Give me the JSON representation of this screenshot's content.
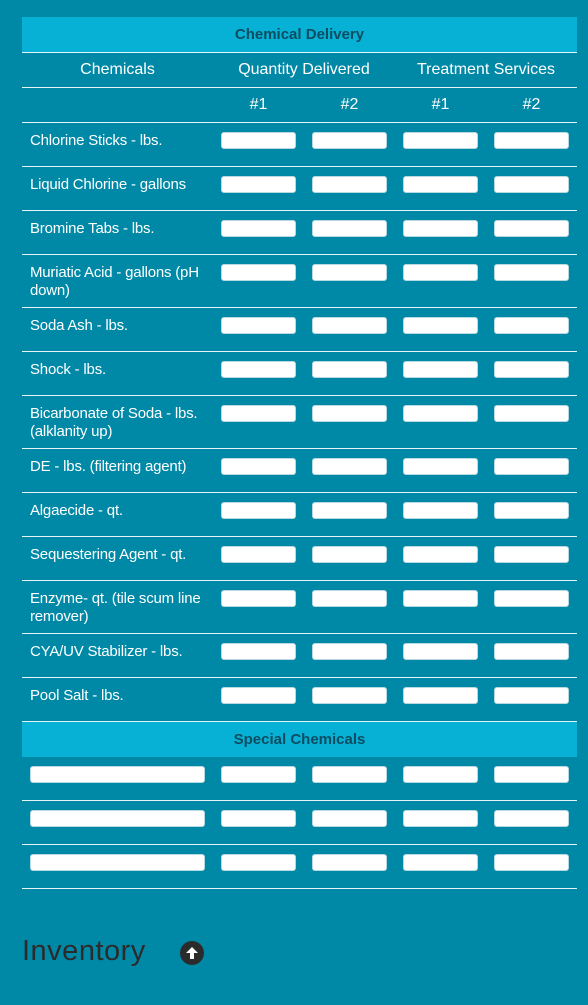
{
  "section_title": "Chemical Delivery",
  "columns": {
    "chemicals": "Chemicals",
    "quantity_delivered": "Quantity Delivered",
    "treatment_services": "Treatment Services",
    "num1": "#1",
    "num2": "#2"
  },
  "chemicals": [
    {
      "label": "Chlorine Sticks - lbs.",
      "lines": 1
    },
    {
      "label": "Liquid Chlorine - gallons",
      "lines": 1
    },
    {
      "label": "Bromine Tabs - lbs.",
      "lines": 1
    },
    {
      "label": "Muriatic Acid - gallons (pH down)",
      "lines": 2
    },
    {
      "label": "Soda Ash - lbs.",
      "lines": 1
    },
    {
      "label": "Shock - lbs.",
      "lines": 1
    },
    {
      "label": "Bicarbonate of Soda - lbs. (alklanity up)",
      "lines": 2
    },
    {
      "label": "DE - lbs. (filtering agent)",
      "lines": 1
    },
    {
      "label": "Algaecide - qt.",
      "lines": 1
    },
    {
      "label": "Sequestering Agent - qt.",
      "lines": 1
    },
    {
      "label": "Enzyme- qt. (tile scum line remover)",
      "lines": 2
    },
    {
      "label": "CYA/UV Stabilizer - lbs.",
      "lines": 1
    },
    {
      "label": "Pool Salt - lbs.",
      "lines": 1
    }
  ],
  "special_title": "Special Chemicals",
  "special_rows": 3,
  "inventory_label": "Inventory",
  "icons": {
    "scroll_up": "arrow-up-circle-icon"
  },
  "colors": {
    "background": "#0089A7",
    "header_bar": "#07B1D6",
    "header_text": "#0C4D61"
  }
}
